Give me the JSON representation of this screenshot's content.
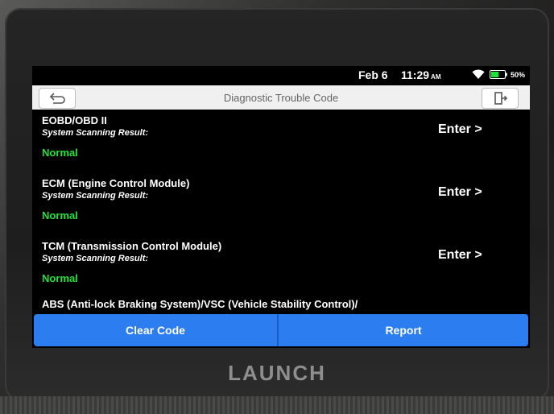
{
  "status_bar": {
    "date": "Feb 6",
    "time": "11:29",
    "ampm": "AM",
    "battery": "50%",
    "wifi_icon": "wifi-icon",
    "battery_icon": "battery-icon"
  },
  "header": {
    "title": "Diagnostic Trouble Code",
    "back_icon": "back-arrow-icon",
    "exit_icon": "exit-icon"
  },
  "items": [
    {
      "name": "EOBD/OBD II",
      "label": "System Scanning Result:",
      "status": "Normal",
      "action": "Enter >"
    },
    {
      "name": "ECM (Engine Control Module)",
      "label": "System Scanning Result:",
      "status": "Normal",
      "action": "Enter >"
    },
    {
      "name": "TCM (Transmission Control Module)",
      "label": "System Scanning Result:",
      "status": "Normal",
      "action": "Enter >"
    }
  ],
  "partial_item": "ABS (Anti-lock Braking System)/VSC (Vehicle Stability Control)/",
  "buttons": {
    "clear": "Clear Code",
    "report": "Report"
  },
  "brand": "LAUNCH",
  "colors": {
    "status_normal": "#22e03a",
    "button_blue": "#2c7df0",
    "title_bar": "#f0f0f0"
  }
}
